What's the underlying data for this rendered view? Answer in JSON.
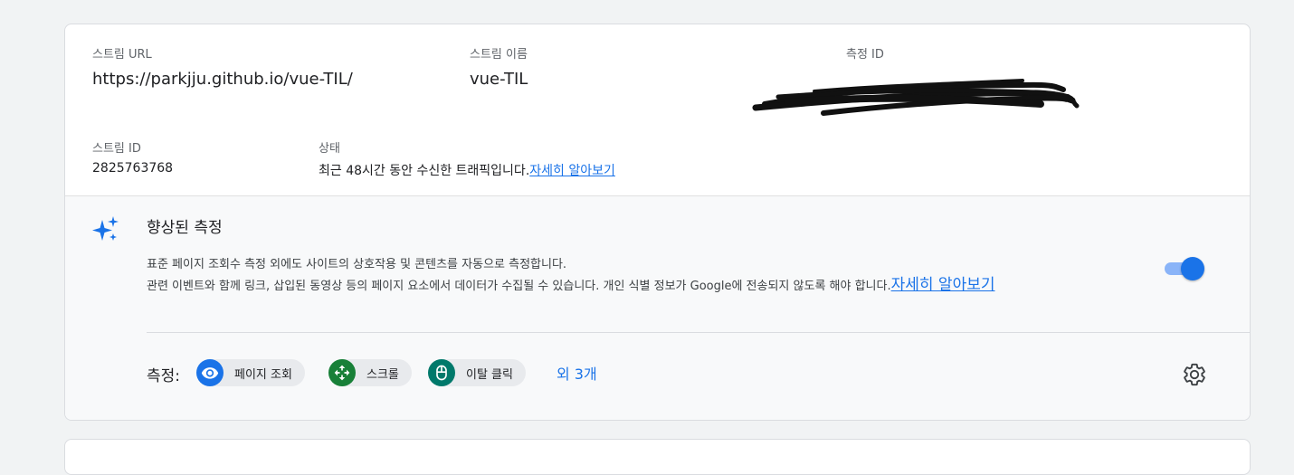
{
  "stream": {
    "url_label": "스트림 URL",
    "url_value": "https://parkjju.github.io/vue-TIL/",
    "name_label": "스트림 이름",
    "name_value": "vue-TIL",
    "measurement_id_label": "측정 ID",
    "stream_id_label": "스트림 ID",
    "stream_id_value": "2825763768",
    "status_label": "상태",
    "status_text": "최근 48시간 동안 수신한 트래픽입니다.",
    "status_link": "자세히 알아보기"
  },
  "enhanced": {
    "title": "향상된 측정",
    "desc_line1": "표준 페이지 조회수 측정 외에도 사이트의 상호작용 및 콘텐츠를 자동으로 측정합니다.",
    "desc_line2": "관련 이벤트와 함께 링크, 삽입된 동영상 등의 페이지 요소에서 데이터가 수집될 수 있습니다. 개인 식별 정보가 Google에 전송되지 않도록 해야 합니다.",
    "learn_more": "자세히 알아보기",
    "toggle_on": true,
    "measure_label": "측정:",
    "chips": [
      {
        "label": "페이지 조회",
        "icon": "eye-icon",
        "color": "#1a73e8"
      },
      {
        "label": "스크롤",
        "icon": "scroll-arrows-icon",
        "color": "#188038"
      },
      {
        "label": "이탈 클릭",
        "icon": "mouse-icon",
        "color": "#00796b"
      }
    ],
    "more_text": "외 3개"
  },
  "colors": {
    "accent": "#1a73e8",
    "toggle_track": "#8ab4f8"
  }
}
